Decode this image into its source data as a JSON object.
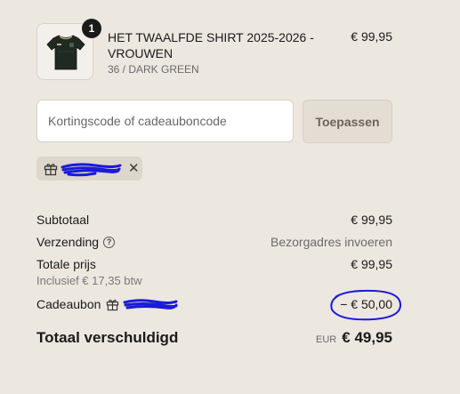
{
  "product": {
    "quantity": "1",
    "title": "HET TWAALFDE SHIRT 2025-2026 - VROUWEN",
    "variant": "36 / DARK GREEN",
    "price": "€ 99,95"
  },
  "discount": {
    "placeholder": "Kortingscode of cadeauboncode",
    "apply_label": "Toepassen"
  },
  "summary": {
    "subtotal_label": "Subtotaal",
    "subtotal_value": "€ 99,95",
    "shipping_label": "Verzending",
    "shipping_value": "Bezorgadres invoeren",
    "total_price_label": "Totale prijs",
    "total_price_value": "€ 99,95",
    "tax_note": "Inclusief € 17,35 btw",
    "giftcard_label": "Cadeaubon",
    "giftcard_value": "− € 50,00",
    "due_label": "Totaal verschuldigd",
    "due_currency": "EUR",
    "due_value": "€ 49,95"
  },
  "colors": {
    "background": "#ece7df",
    "scribble": "#1a1adb",
    "text": "#1a1a1a"
  },
  "icons": [
    "gift-icon",
    "close-icon",
    "help-icon"
  ]
}
